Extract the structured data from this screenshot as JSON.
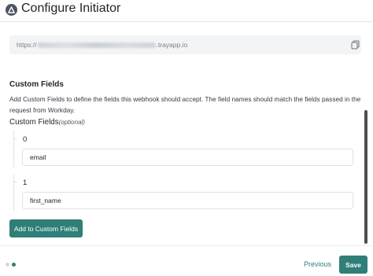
{
  "header": {
    "title": "Configure Initiator",
    "logo_icon": "tray-logo-icon"
  },
  "webhook": {
    "url_prefix": "https://",
    "url_suffix": ".trayapp.io",
    "copy_icon": "copy-icon"
  },
  "custom_fields": {
    "heading": "Custom Fields",
    "description": "Add Custom Fields to define the fields this webhook should accept. The field names should match the fields passed in the request from Workday.",
    "label": "Custom Fields",
    "optional_label": "(optional)",
    "items": [
      {
        "index": "0",
        "value": "email"
      },
      {
        "index": "1",
        "value": "first_name"
      }
    ],
    "add_button_label": "Add to Custom Fields"
  },
  "footer": {
    "previous_label": "Previous",
    "save_label": "Save",
    "steps_total": 2,
    "current_step": 2
  },
  "colors": {
    "accent": "#2f7f78",
    "input_border": "#dfe2e6",
    "url_background": "#f2f4f6"
  }
}
